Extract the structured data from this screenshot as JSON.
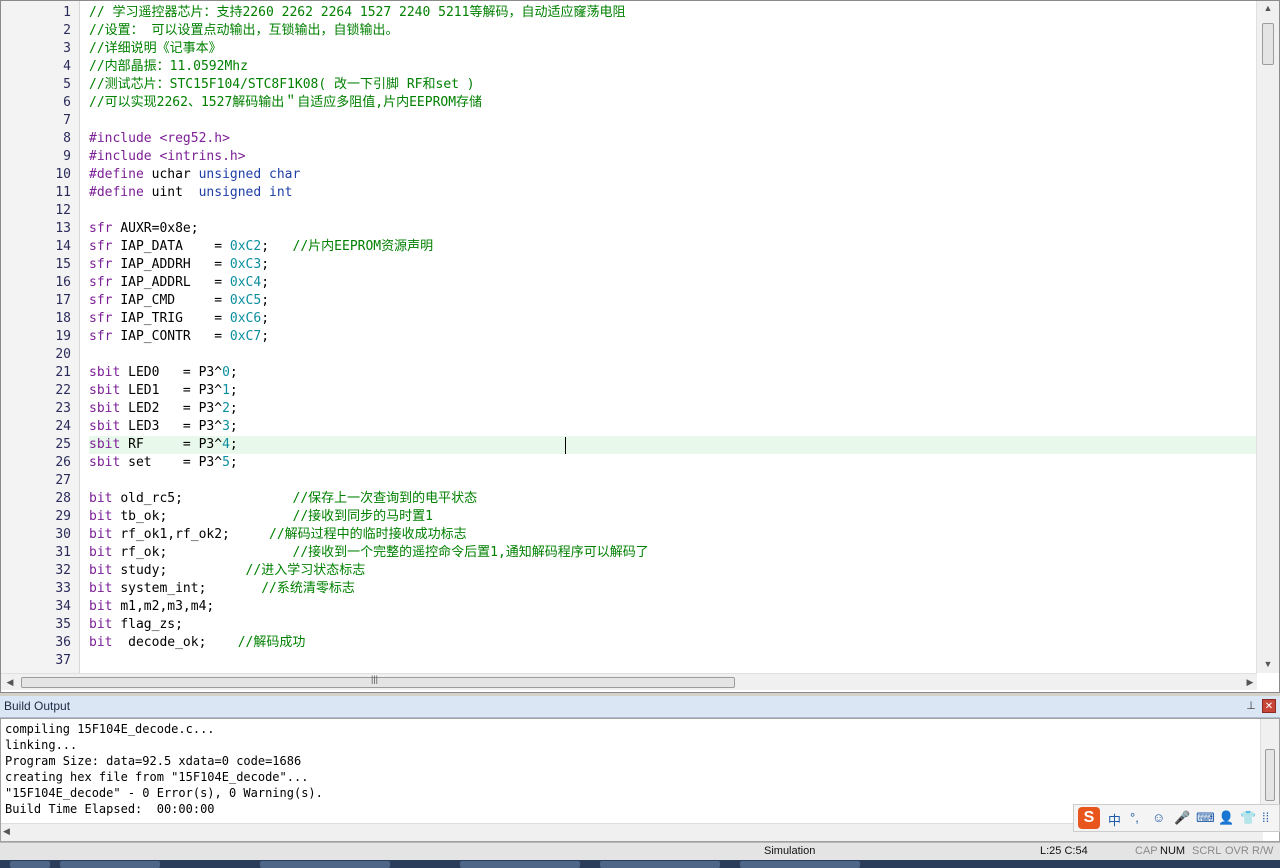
{
  "editor": {
    "line_numbers": [
      "1",
      "2",
      "3",
      "4",
      "5",
      "6",
      "7",
      "8",
      "9",
      "10",
      "11",
      "12",
      "13",
      "14",
      "15",
      "16",
      "17",
      "18",
      "19",
      "20",
      "21",
      "22",
      "23",
      "24",
      "25",
      "26",
      "27",
      "28",
      "29",
      "30",
      "31",
      "32",
      "33",
      "34",
      "35",
      "36",
      "37"
    ],
    "current_line": 25,
    "lines": [
      [
        [
          "// 学习遥控器芯片：支持2260 2262 2264 1527 2240 5211等解码，自动适应窿荡电阻",
          "comment"
        ]
      ],
      [
        [
          "//设置： 可以设置点动输出，互锁输出，自锁输出。",
          "comment"
        ]
      ],
      [
        [
          "//详细说明《记事本》",
          "comment"
        ]
      ],
      [
        [
          "//内部晶振：11.0592Mhz",
          "comment"
        ]
      ],
      [
        [
          "//测试芯片：STC15F104/STC8F1K08( 改一下引脚 RF和set )",
          "comment"
        ]
      ],
      [
        [
          "//可以实现2262、1527解码输出＂自适应多阻值,片内EEPROM存储",
          "comment"
        ]
      ],
      [],
      [
        [
          "#include ",
          "pre"
        ],
        [
          "<reg52.h>",
          "str"
        ]
      ],
      [
        [
          "#include ",
          "pre"
        ],
        [
          "<intrins.h>",
          "str"
        ]
      ],
      [
        [
          "#define ",
          "pre"
        ],
        [
          "uchar ",
          ""
        ],
        [
          "unsigned char",
          "type"
        ]
      ],
      [
        [
          "#define ",
          "pre"
        ],
        [
          "uint  ",
          ""
        ],
        [
          "unsigned int",
          "type"
        ]
      ],
      [],
      [
        [
          "sfr ",
          "kw"
        ],
        [
          "AUXR=",
          ""
        ],
        [
          "0x8e",
          ""
        ],
        [
          ";",
          ""
        ]
      ],
      [
        [
          "sfr ",
          "kw"
        ],
        [
          "IAP_DATA    = ",
          ""
        ],
        [
          "0xC2",
          "num"
        ],
        [
          ";   ",
          ""
        ],
        [
          "//片内EEPROM资源声明",
          "comment"
        ]
      ],
      [
        [
          "sfr ",
          "kw"
        ],
        [
          "IAP_ADDRH   = ",
          ""
        ],
        [
          "0xC3",
          "num"
        ],
        [
          ";",
          ""
        ]
      ],
      [
        [
          "sfr ",
          "kw"
        ],
        [
          "IAP_ADDRL   = ",
          ""
        ],
        [
          "0xC4",
          "num"
        ],
        [
          ";",
          ""
        ]
      ],
      [
        [
          "sfr ",
          "kw"
        ],
        [
          "IAP_CMD     = ",
          ""
        ],
        [
          "0xC5",
          "num"
        ],
        [
          ";",
          ""
        ]
      ],
      [
        [
          "sfr ",
          "kw"
        ],
        [
          "IAP_TRIG    = ",
          ""
        ],
        [
          "0xC6",
          "num"
        ],
        [
          ";",
          ""
        ]
      ],
      [
        [
          "sfr ",
          "kw"
        ],
        [
          "IAP_CONTR   = ",
          ""
        ],
        [
          "0xC7",
          "num"
        ],
        [
          ";",
          ""
        ]
      ],
      [],
      [
        [
          "sbit ",
          "kw"
        ],
        [
          "LED0   = P3^",
          ""
        ],
        [
          "0",
          "num"
        ],
        [
          ";",
          ""
        ]
      ],
      [
        [
          "sbit ",
          "kw"
        ],
        [
          "LED1   = P3^",
          ""
        ],
        [
          "1",
          "num"
        ],
        [
          ";",
          ""
        ]
      ],
      [
        [
          "sbit ",
          "kw"
        ],
        [
          "LED2   = P3^",
          ""
        ],
        [
          "2",
          "num"
        ],
        [
          ";",
          ""
        ]
      ],
      [
        [
          "sbit ",
          "kw"
        ],
        [
          "LED3   = P3^",
          ""
        ],
        [
          "3",
          "num"
        ],
        [
          ";",
          ""
        ]
      ],
      [
        [
          "sbit ",
          "kw"
        ],
        [
          "RF     = P3^",
          ""
        ],
        [
          "4",
          "num"
        ],
        [
          ";",
          ""
        ]
      ],
      [
        [
          "sbit ",
          "kw"
        ],
        [
          "set    = P3^",
          ""
        ],
        [
          "5",
          "num"
        ],
        [
          ";",
          ""
        ]
      ],
      [],
      [
        [
          "bit ",
          "kw"
        ],
        [
          "old_rc5;              ",
          ""
        ],
        [
          "//保存上一次查询到的电平状态",
          "comment"
        ]
      ],
      [
        [
          "bit ",
          "kw"
        ],
        [
          "tb_ok;                ",
          ""
        ],
        [
          "//接收到同步的马时置1",
          "comment"
        ]
      ],
      [
        [
          "bit ",
          "kw"
        ],
        [
          "rf_ok1,rf_ok2;     ",
          ""
        ],
        [
          "//解码过程中的临时接收成功标志",
          "comment"
        ]
      ],
      [
        [
          "bit ",
          "kw"
        ],
        [
          "rf_ok;                ",
          ""
        ],
        [
          "//接收到一个完整的遥控命令后置1,通知解码程序可以解码了",
          "comment"
        ]
      ],
      [
        [
          "bit ",
          "kw"
        ],
        [
          "study;          ",
          ""
        ],
        [
          "//进入学习状态标志",
          "comment"
        ]
      ],
      [
        [
          "bit ",
          "kw"
        ],
        [
          "system_int;       ",
          ""
        ],
        [
          "//系统清零标志",
          "comment"
        ]
      ],
      [
        [
          "bit ",
          "kw"
        ],
        [
          "m1,m2,m3,m4;",
          ""
        ]
      ],
      [
        [
          "bit ",
          "kw"
        ],
        [
          "flag_zs;",
          ""
        ]
      ],
      [
        [
          "bit  ",
          "kw"
        ],
        [
          "decode_ok;    ",
          ""
        ],
        [
          "//解码成功",
          "comment"
        ]
      ],
      []
    ]
  },
  "build_output": {
    "title": "Build Output",
    "lines": [
      "compiling 15F104E_decode.c...",
      "linking...",
      "Program Size: data=92.5 xdata=0 code=1686",
      "creating hex file from \"15F104E_decode\"...",
      "\"15F104E_decode\" - 0 Error(s), 0 Warning(s).",
      "Build Time Elapsed:  00:00:00"
    ]
  },
  "ime": {
    "logo": "S",
    "items": [
      "中",
      "°,",
      "☺",
      "🎤",
      "⌨",
      "👤",
      "👕",
      "⁞⁞"
    ]
  },
  "status_bar": {
    "mode": "Simulation",
    "position": "L:25 C:54",
    "cap": "CAP",
    "num": "NUM",
    "scrl": "SCRL",
    "ovr": "OVR",
    "rw": "R/W"
  },
  "colors": {
    "comment": "#008000",
    "keyword": "#7c1f96",
    "type": "#1f3fa7",
    "number": "#0a8f9f",
    "current_line_bg": "#e8f9ec"
  }
}
